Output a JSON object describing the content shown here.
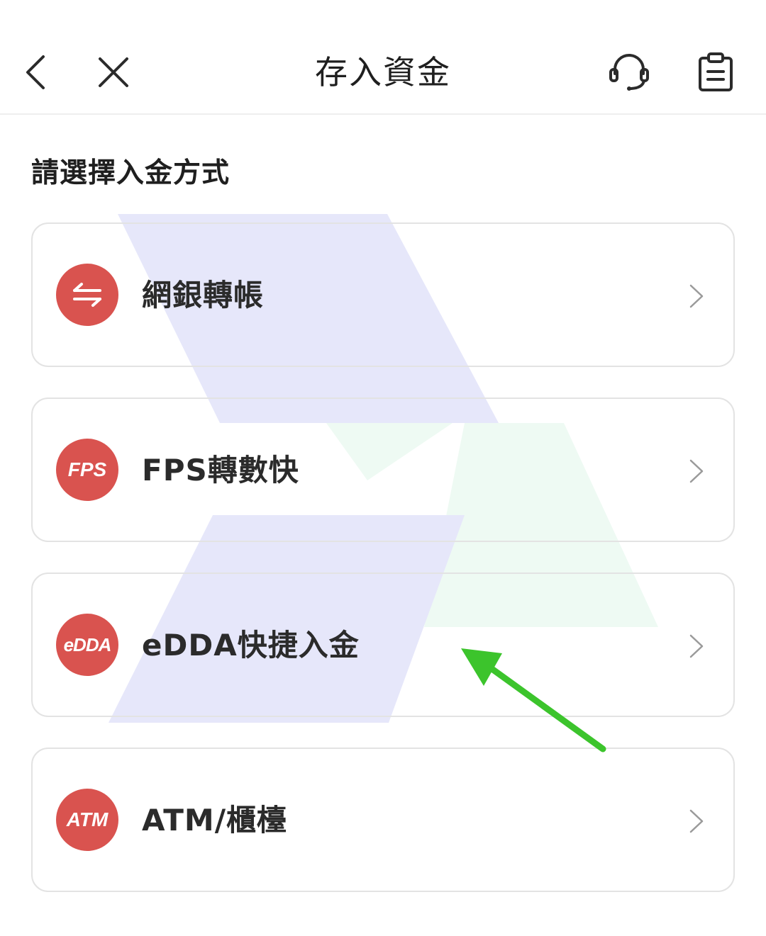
{
  "header": {
    "title": "存入資金",
    "back_icon": "chevron-left-icon",
    "close_icon": "close-icon",
    "support_icon": "headset-icon",
    "records_icon": "clipboard-icon"
  },
  "section_title": "請選擇入金方式",
  "options": [
    {
      "label": "網銀轉帳",
      "icon_text": "",
      "icon": "transfer-arrows-icon"
    },
    {
      "label": "FPS轉數快",
      "icon_text": "FPS",
      "icon": "fps-badge-icon"
    },
    {
      "label": "eDDA快捷入金",
      "icon_text": "eDDA",
      "icon": "edda-badge-icon"
    },
    {
      "label": "ATM/櫃檯",
      "icon_text": "ATM",
      "icon": "atm-badge-icon"
    }
  ],
  "colors": {
    "icon_background": "#d9534f",
    "annotation_arrow": "#3cc42c",
    "watermark_blue": "#e6e7fa",
    "watermark_green": "#eefaf3",
    "card_border": "#e3e3e3"
  }
}
